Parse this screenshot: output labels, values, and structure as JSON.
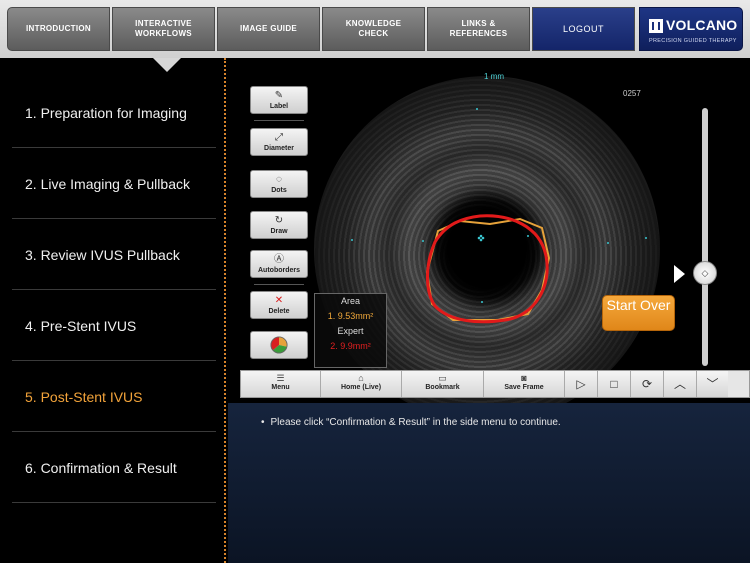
{
  "nav": {
    "items": [
      {
        "label": "INTRODUCTION"
      },
      {
        "label": "INTERACTIVE\nWORKFLOWS"
      },
      {
        "label": "IMAGE GUIDE"
      },
      {
        "label": "KNOWLEDGE\nCHECK"
      },
      {
        "label": "LINKS &\nREFERENCES"
      }
    ],
    "logout_label": "LOGOUT",
    "brand_name": "VOLCANO",
    "brand_tagline": "PRECISION GUIDED THERAPY"
  },
  "sidebar": {
    "items": [
      {
        "label": "1. Preparation for Imaging"
      },
      {
        "label": "2. Live Imaging & Pullback"
      },
      {
        "label": "3. Review IVUS Pullback"
      },
      {
        "label": "4. Pre-Stent IVUS"
      },
      {
        "label": "5. Post-Stent IVUS",
        "active": true
      },
      {
        "label": "6. Confirmation & Result"
      }
    ]
  },
  "viewer": {
    "scale_label": "1 mm",
    "frame_number": "0257",
    "tools": {
      "label": "Label",
      "diameter": "Diameter",
      "dots": "Dots",
      "draw": "Draw",
      "autoborders": "Autoborders",
      "delete": "Delete"
    },
    "area_box": {
      "title": "Area",
      "user_value": "1. 9.53mm²",
      "expert_label": "Expert",
      "expert_value": "2. 9.9mm²"
    },
    "start_over_label": "Start Over",
    "toolbar": {
      "menu": "Menu",
      "home": "Home (Live)",
      "bookmark": "Bookmark",
      "save_frame": "Save Frame"
    }
  },
  "instructions": {
    "text": "Please click “Confirmation & Result” in the side menu to continue."
  },
  "colors": {
    "accent_orange": "#f2a33a",
    "expert_contour": "#e02020",
    "user_contour": "#f0a83a",
    "brand_blue": "#1e3685"
  }
}
